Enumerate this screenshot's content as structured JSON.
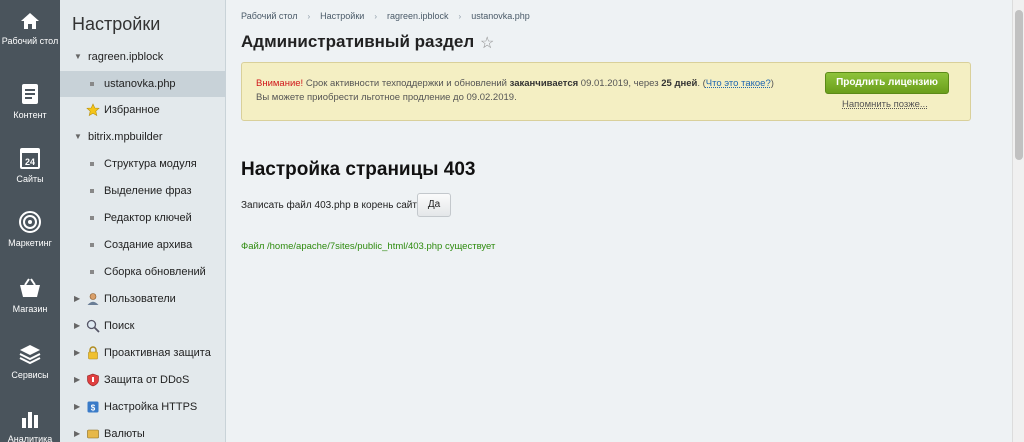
{
  "rail": [
    {
      "label": "Рабочий стол",
      "icon": "home-icon"
    },
    {
      "label": "Контент",
      "icon": "document-icon"
    },
    {
      "label": "Сайты",
      "icon": "calendar-icon",
      "badge": "24"
    },
    {
      "label": "Маркетинг",
      "icon": "target-icon"
    },
    {
      "label": "Магазин",
      "icon": "basket-icon"
    },
    {
      "label": "Сервисы",
      "icon": "layers-icon"
    },
    {
      "label": "Аналитика",
      "icon": "chart-icon"
    }
  ],
  "panel": {
    "title": "Настройки",
    "items": [
      {
        "label": "ragreen.ipblock",
        "arrow": "▼"
      },
      {
        "label": "ustanovka.php"
      },
      {
        "label": "Избранное",
        "icon": "star-icon"
      },
      {
        "label": "bitrix.mpbuilder",
        "arrow": "▼"
      },
      {
        "label": "Структура модуля"
      },
      {
        "label": "Выделение фраз"
      },
      {
        "label": "Редактор ключей"
      },
      {
        "label": "Создание архива"
      },
      {
        "label": "Сборка обновлений"
      },
      {
        "label": "Пользователи",
        "arrow": "▶",
        "icon": "user-icon"
      },
      {
        "label": "Поиск",
        "arrow": "▶",
        "icon": "magnifier-icon"
      },
      {
        "label": "Проактивная защита",
        "arrow": "▶",
        "icon": "lock-icon"
      },
      {
        "label": "Защита от DDoS",
        "arrow": "▶",
        "icon": "shield-icon"
      },
      {
        "label": "Настройка HTTPS",
        "arrow": "▶",
        "icon": "https-icon"
      },
      {
        "label": "Валюты",
        "arrow": "▶",
        "icon": "currency-icon"
      }
    ]
  },
  "breadcrumb": [
    "Рабочий стол",
    "Настройки",
    "ragreen.ipblock",
    "ustanovka.php"
  ],
  "page_title": "Административный раздел",
  "notice": {
    "warning": "Внимание!",
    "text1": " Срок активности техподдержки и обновлений ",
    "expires": "заканчивается",
    "text2": " 09.01.2019, через ",
    "days": "25 дней",
    "text3": ". (",
    "what_link": "Что это такое?",
    "text4": ")",
    "line2": "Вы можете приобрести льготное продление до 09.02.2019.",
    "renew_label": "Продлить лицензию",
    "remind_label": "Напомнить позже..."
  },
  "section_title": "Настройка страницы 403",
  "write_label": "Записать файл 403.php в корень сайта",
  "yes_label": "Да",
  "result_text": "Файл /home/apache/7sites/public_html/403.php существует",
  "colors": {
    "accent": "#6a9e1b",
    "warning": "#d0181b",
    "success": "#2e8b0e"
  }
}
